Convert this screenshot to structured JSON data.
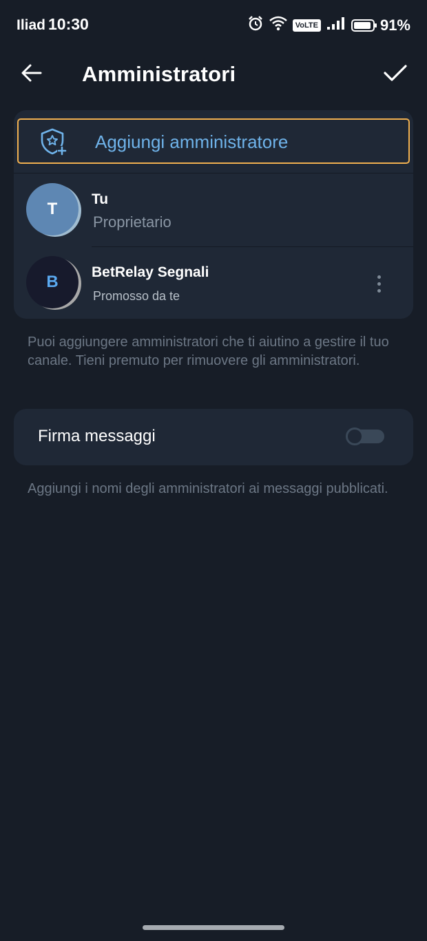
{
  "status_bar": {
    "carrier": "Iliad",
    "time": "10:30",
    "volte": "VoLTE",
    "battery": "91%",
    "battery_level": 0.91
  },
  "header": {
    "title": "Amministratori"
  },
  "admins": {
    "add_label": "Aggiungi amministratore",
    "items": [
      {
        "initial": "T",
        "name": "Tu",
        "role": "Proprietario"
      },
      {
        "initial": "B",
        "name": "BetRelay Segnali",
        "role": "Promosso da te"
      }
    ],
    "hint": "Puoi aggiungere amministratori che ti aiutino a gestire il tuo canale. Tieni premuto per rimuovere gli amministratori."
  },
  "sign_messages": {
    "label": "Firma messaggi",
    "enabled": false,
    "hint": "Aggiungi i nomi degli amministratori ai messaggi pubblicati."
  },
  "colors": {
    "background": "#171d27",
    "card": "#1f2836",
    "accent": "#6fb3ea",
    "focus_border": "#f0b050"
  }
}
